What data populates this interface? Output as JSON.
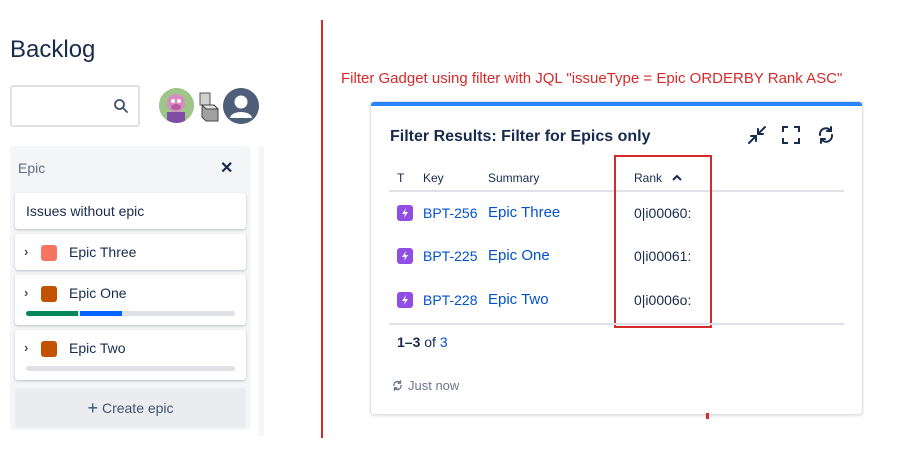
{
  "backlog": {
    "title": "Backlog",
    "search": {
      "placeholder": "",
      "value": ""
    },
    "epic_panel": {
      "header": "Epic",
      "no_epic_label": "Issues without epic",
      "epics": [
        {
          "name": "Epic Three",
          "color": "#f87462",
          "progress": null
        },
        {
          "name": "Epic One",
          "color": "#c25100",
          "progress": {
            "done": 0.25,
            "in_progress": 0.2
          }
        },
        {
          "name": "Epic Two",
          "color": "#c25100",
          "progress": {
            "done": 0,
            "in_progress": 0
          }
        }
      ],
      "create_label": "Create epic"
    }
  },
  "annotation": "Filter Gadget using filter with JQL \"issueType = Epic ORDERBY Rank ASC\"",
  "gadget": {
    "title": "Filter Results: Filter for Epics only",
    "columns": {
      "type": "T",
      "key": "Key",
      "summary": "Summary",
      "rank": "Rank"
    },
    "rows": [
      {
        "key": "BPT-256",
        "summary": "Epic Three",
        "rank": "0|i00060:"
      },
      {
        "key": "BPT-225",
        "summary": "Epic One",
        "rank": "0|i00061:"
      },
      {
        "key": "BPT-228",
        "summary": "Epic Two",
        "rank": "0|i0006o:"
      }
    ],
    "pager": {
      "range": "1–3",
      "of": "of",
      "total": "3"
    },
    "refreshed": "Just now"
  },
  "colors": {
    "accent": "#2684ff",
    "link": "#0052cc",
    "annotation": "#d62a2a",
    "epic_issue_icon": "#904ee2"
  }
}
